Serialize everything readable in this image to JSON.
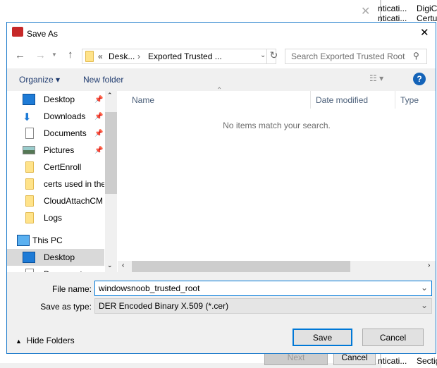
{
  "background": {
    "right_col1": [
      "nticati...",
      "nticati...",
      "nticati...",
      "nticati..."
    ],
    "right_col2": [
      "DigiC",
      "Certu",
      "Sectig",
      "Sectig"
    ],
    "next_label": "Next",
    "cancel_label": "Cancel"
  },
  "dialog": {
    "title": "Save As",
    "close": "close-icon"
  },
  "address": {
    "crumbs": [
      "Desk...",
      "Exported Trusted ..."
    ],
    "prefix": "«",
    "sep": "›"
  },
  "search": {
    "placeholder": "Search Exported Trusted Root"
  },
  "toolbar": {
    "organize": "Organize",
    "new_folder": "New folder"
  },
  "nav": {
    "quick": [
      {
        "label": "Desktop",
        "icon": "desktop-icon",
        "pinned": true
      },
      {
        "label": "Downloads",
        "icon": "downloads-icon",
        "pinned": true
      },
      {
        "label": "Documents",
        "icon": "documents-icon",
        "pinned": true
      },
      {
        "label": "Pictures",
        "icon": "pictures-icon",
        "pinned": true
      },
      {
        "label": "CertEnroll",
        "icon": "network-folder-icon",
        "pinned": false
      },
      {
        "label": "certs used in the",
        "icon": "folder-icon",
        "pinned": false
      },
      {
        "label": "CloudAttachCM",
        "icon": "folder-icon",
        "pinned": false
      },
      {
        "label": "Logs",
        "icon": "folder-icon",
        "pinned": false
      }
    ],
    "this_pc": "This PC",
    "pc_items": [
      {
        "label": "Desktop",
        "selected": true
      },
      {
        "label": "Documents"
      }
    ]
  },
  "files": {
    "columns": [
      "Name",
      "Date modified",
      "Type"
    ],
    "empty": "No items match your search."
  },
  "form": {
    "file_name_label": "File name:",
    "file_name_value": "windowsnoob_trusted_root",
    "type_label": "Save as type:",
    "type_value": "DER Encoded Binary X.509 (*.cer)"
  },
  "footer": {
    "hide_folders": "Hide Folders",
    "save": "Save",
    "cancel": "Cancel"
  },
  "colors": {
    "accent": "#0078d7",
    "selected": "#d9d9d9"
  }
}
